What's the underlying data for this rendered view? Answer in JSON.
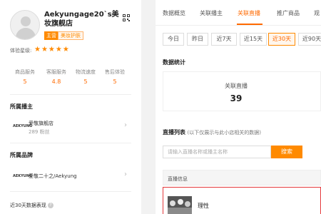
{
  "shop": {
    "name": "Aekyungage20`s美妆旗舰店",
    "tag_main": "主营",
    "tag_category": "美妆护肤",
    "experience_label": "体验星级:",
    "stars": "★★★★★",
    "star_rating": 5,
    "scores": [
      {
        "label": "商品服务",
        "value": "5"
      },
      {
        "label": "客服服务",
        "value": "4.8"
      },
      {
        "label": "物流速度",
        "value": "5"
      },
      {
        "label": "售后体验",
        "value": "5"
      }
    ]
  },
  "anchors": {
    "title": "所属播主",
    "items": [
      {
        "logo": "AEKYUNG",
        "name": "爱敬旗舰店",
        "fans": "289 粉丝"
      }
    ]
  },
  "brands": {
    "title": "所属品牌",
    "items": [
      {
        "logo": "AEKYUNG",
        "name": "爱敬二十之/Aekyung"
      }
    ]
  },
  "bottom_label": "近30天数据表现",
  "bottom_help_icon": "?",
  "nav_tabs": [
    {
      "label": "数据概览",
      "active": false
    },
    {
      "label": "关联播主",
      "active": false
    },
    {
      "label": "关联直播",
      "active": true
    },
    {
      "label": "推广商品",
      "active": false
    },
    {
      "label": "观",
      "active": false
    }
  ],
  "periods": [
    {
      "label": "今日",
      "active": false
    },
    {
      "label": "昨日",
      "active": false
    },
    {
      "label": "近7天",
      "active": false
    },
    {
      "label": "近15天",
      "active": false
    },
    {
      "label": "近30天",
      "active": true
    },
    {
      "label": "近90天",
      "active": false
    }
  ],
  "stats": {
    "heading": "数据统计",
    "label": "关联直播",
    "value": "39"
  },
  "live_list": {
    "title": "直播列表",
    "note": "(以下仅展示与此小店相关的数据)",
    "search_placeholder": "请输入直播名称或播主名称",
    "search_button": "搜索",
    "table_header": "直播信息",
    "rows": [
      {
        "title": "理性"
      }
    ]
  },
  "colors": {
    "accent": "#ff6a00",
    "accent_btn": "#ff8a00",
    "highlight_border": "#e4393c"
  }
}
